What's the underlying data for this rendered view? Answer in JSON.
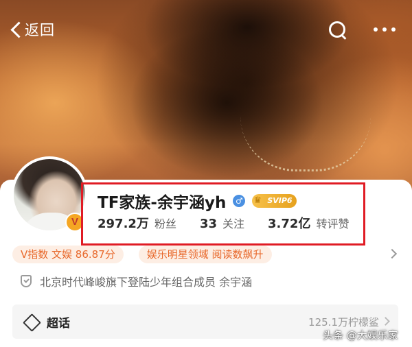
{
  "nav": {
    "back_label": "返回"
  },
  "profile": {
    "name": "TF家族-余宇涵yh",
    "gender_symbol": "♂",
    "svip_label": "SVIP6",
    "verified_badge": "V",
    "stats": [
      {
        "value": "297.2万",
        "label": "粉丝"
      },
      {
        "value": "33",
        "label": "关注"
      },
      {
        "value": "3.72亿",
        "label": "转评赞"
      }
    ]
  },
  "tags": [
    "V指数 文娱 86.87分",
    "娱乐明星领域 阅读数飙升"
  ],
  "bio": {
    "text": "北京时代峰峻旗下登陆少年组合成员 余宇涵"
  },
  "supertopic": {
    "label": "超话",
    "meta": "125.1万柠檬鲨"
  },
  "watermark": "头条 @大娱乐家",
  "colors": {
    "highlight_border": "#e01b24",
    "tag_text": "#e8692c",
    "tag_bg": "#fdeee4",
    "svip_gold": "#f0b43a",
    "gender_blue": "#4a90e2"
  }
}
